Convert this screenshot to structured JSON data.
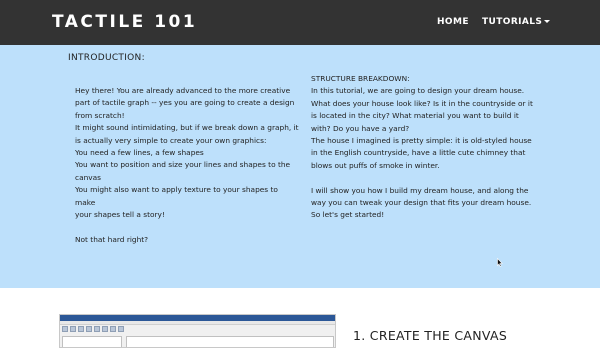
{
  "navbar": {
    "brand": "TACTILE 101",
    "home": "HOME",
    "tutorials": "TUTORIALS"
  },
  "intro": {
    "heading": "INTRODUCTION:",
    "left_lines": [
      "Hey there! You are already advanced to the more creative",
      "part of tactile graph -- yes you are going to create a design",
      "from scratch!",
      "It might sound intimidating, but if we break down a graph, it",
      "is actually very simple to create your own graphics:",
      "You need a few lines, a few shapes",
      "You want to position and size your lines and shapes to the",
      "canvas",
      "You might also want to apply texture to your shapes to make",
      "your shapes tell a story!",
      "",
      "Not that hard right?"
    ],
    "right_lines": [
      "STRUCTURE BREAKDOWN:",
      "In this tutorial, we are going to design your dream house.",
      "What does your house look like? Is it in the countryside or it",
      "is located in the city? What material you want to build it",
      "with? Do you have a yard?",
      "The house I imagined is pretty simple: it is old-styled house",
      "in the English countryside, have a little cute chimney that",
      "blows out puffs of smoke in winter.",
      "",
      "I will show you how I build my dream house, and along the",
      "way you can tweak your design that fits your dream house.",
      "So let's get started!"
    ]
  },
  "canvas_section": {
    "heading": "1. CREATE THE CANVAS"
  },
  "icons": {
    "caret": "caret-down-icon",
    "cursor": "mouse-pointer-icon"
  },
  "colors": {
    "navbar_bg": "#333333",
    "intro_bg": "#bde0fb"
  }
}
